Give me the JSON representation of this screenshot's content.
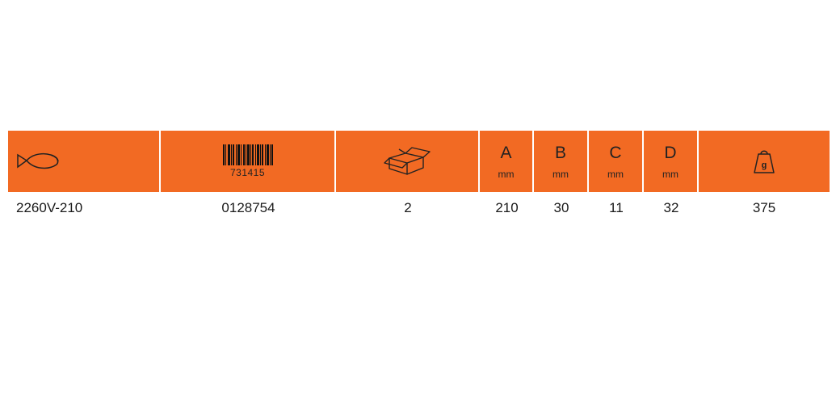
{
  "header": {
    "icons": {
      "product": "fish-icon",
      "barcode": "barcode-icon",
      "package": "box-icon",
      "weight": "weight-icon"
    },
    "barcode_number": "731415",
    "dimensions": [
      {
        "letter": "A",
        "unit": "mm"
      },
      {
        "letter": "B",
        "unit": "mm"
      },
      {
        "letter": "C",
        "unit": "mm"
      },
      {
        "letter": "D",
        "unit": "mm"
      }
    ],
    "weight_icon_label": "g",
    "header_color": "#f26a23"
  },
  "row": {
    "article": "2260V-210",
    "ean": "0128754",
    "pack_qty": "2",
    "a": "210",
    "b": "30",
    "c": "11",
    "d": "32",
    "weight": "375"
  }
}
